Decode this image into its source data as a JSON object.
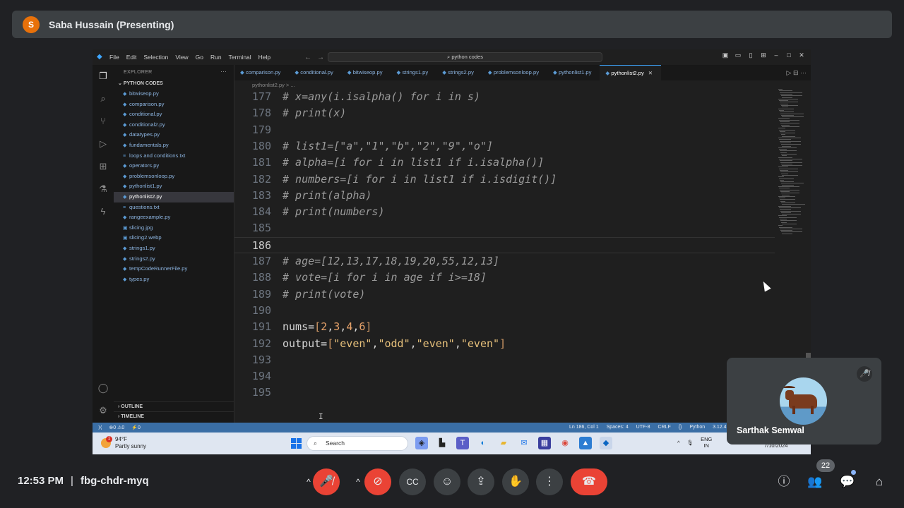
{
  "meet": {
    "presenter_initial": "S",
    "presenter_label": "Saba Hussain (Presenting)",
    "time": "12:53 PM",
    "separator": "|",
    "meeting_code": "fbg-chdr-myq",
    "people_count": "22",
    "participant_name": "Sarthak Semwal"
  },
  "vscode": {
    "menu": [
      "File",
      "Edit",
      "Selection",
      "View",
      "Go",
      "Run",
      "Terminal",
      "Help"
    ],
    "search_placeholder": "python codes",
    "explorer_title": "EXPLORER",
    "folder": "PYTHON CODES",
    "files": [
      "bitwiseop.py",
      "comparison.py",
      "conditional.py",
      "conditional2.py",
      "datatypes.py",
      "fundamentals.py",
      "loops and conditions.txt",
      "operators.py",
      "problemsonloop.py",
      "pythonlist1.py",
      "pythonlist2.py",
      "questions.txt",
      "rangeexample.py",
      "slicing.jpg",
      "slicing2.webp",
      "strings1.py",
      "strings2.py",
      "tempCodeRunnerFile.py",
      "types.py"
    ],
    "outline": "OUTLINE",
    "timeline": "TIMELINE",
    "tabs": [
      "comparison.py",
      "conditional.py",
      "bitwiseop.py",
      "strings1.py",
      "strings2.py",
      "problemsonloop.py",
      "pythonlist1.py",
      "pythonlist2.py"
    ],
    "breadcrumb": "pythonlist2.py > ...",
    "code": [
      {
        "n": "177",
        "t": "# x=any(i.isalpha() for i in s)"
      },
      {
        "n": "178",
        "t": "# print(x)"
      },
      {
        "n": "179",
        "t": ""
      },
      {
        "n": "180",
        "t": "# list1=[\"a\",\"1\",\"b\",\"2\",\"9\",\"o\"]"
      },
      {
        "n": "181",
        "t": "# alpha=[i for i in list1 if i.isalpha()]"
      },
      {
        "n": "182",
        "t": "# numbers=[i for i in list1 if i.isdigit()]"
      },
      {
        "n": "183",
        "t": "# print(alpha)"
      },
      {
        "n": "184",
        "t": "# print(numbers)"
      },
      {
        "n": "185",
        "t": ""
      },
      {
        "n": "186",
        "t": ""
      },
      {
        "n": "187",
        "t": "# age=[12,13,17,18,19,20,55,12,13]"
      },
      {
        "n": "188",
        "t": "# vote=[i for i in age if i>=18]"
      },
      {
        "n": "189",
        "t": "# print(vote)"
      },
      {
        "n": "190",
        "t": ""
      },
      {
        "n": "191",
        "t": "nums=[2,3,4,6]"
      },
      {
        "n": "192",
        "t": "output=[\"even\",\"odd\",\"even\",\"even\"]"
      },
      {
        "n": "193",
        "t": ""
      },
      {
        "n": "194",
        "t": ""
      },
      {
        "n": "195",
        "t": ""
      }
    ],
    "status": {
      "errors": "⊗0 ⚠0",
      "ports": "⚡0",
      "position": "Ln 186, Col 1",
      "spaces": "Spaces: 4",
      "encoding": "UTF-8",
      "eol": "CRLF",
      "language": "Python",
      "interpreter": "3.12.4 64-bit"
    }
  },
  "taskbar": {
    "temp": "94°F",
    "weather": "Partly sunny",
    "search": "Search",
    "lang_1": "ENG",
    "lang_2": "IN",
    "date": "7/10/2024"
  },
  "colors": {
    "accent": "#3ea6ff",
    "status_bar": "#3a6ea5",
    "end_call": "#ea4335"
  }
}
